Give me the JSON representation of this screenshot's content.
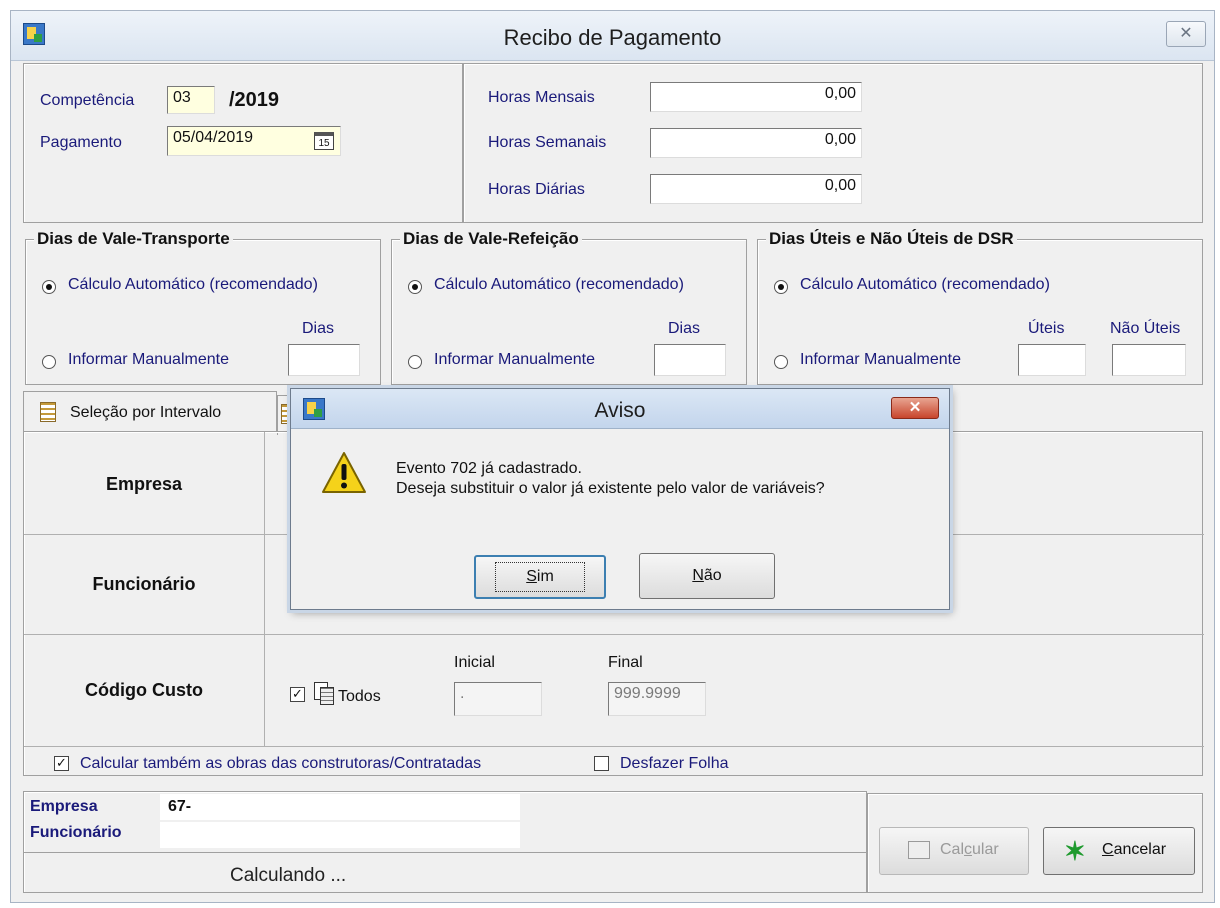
{
  "window": {
    "title": "Recibo de Pagamento",
    "close_glyph": "✕"
  },
  "competencia": {
    "label": "Competência",
    "month": "03",
    "year": "/2019"
  },
  "pagamento": {
    "label": "Pagamento",
    "date": "05/04/2019",
    "cal_glyph": "15"
  },
  "horas": {
    "mensais_label": "Horas Mensais",
    "mensais_value": "0,00",
    "semanais_label": "Horas Semanais",
    "semanais_value": "0,00",
    "diarias_label": "Horas Diárias",
    "diarias_value": "0,00"
  },
  "vale_transporte": {
    "title": "Dias de Vale-Transporte",
    "auto_label": "Cálculo Automático (recomendado)",
    "manual_label": "Informar Manualmente",
    "dias_label": "Dias"
  },
  "vale_refeicao": {
    "title": "Dias de Vale-Refeição",
    "auto_label": "Cálculo Automático (recomendado)",
    "manual_label": "Informar Manualmente",
    "dias_label": "Dias"
  },
  "dsr": {
    "title": "Dias Úteis e Não Úteis de DSR",
    "auto_label": "Cálculo Automático (recomendado)",
    "manual_label": "Informar Manualmente",
    "uteis_label": "Úteis",
    "nao_uteis_label": "Não Úteis"
  },
  "tabs": {
    "selecao_intervalo": "Seleção por Intervalo"
  },
  "rows": {
    "empresa": "Empresa",
    "funcionario": "Funcionário",
    "codigo_custo": "Código Custo"
  },
  "custo": {
    "todos_label": "Todos",
    "inicial_label": "Inicial",
    "inicial_value": ".",
    "final_label": "Final",
    "final_value": "999.9999"
  },
  "options": {
    "calcular_obras": "Calcular também as obras das construtoras/Contratadas",
    "desfazer_folha": "Desfazer Folha"
  },
  "status": {
    "empresa_label": "Empresa",
    "empresa_value": "67-",
    "funcionario_label": "Funcionário",
    "progress_text": "Calculando ..."
  },
  "buttons": {
    "calcular_pre": "Cal",
    "calcular_u": "c",
    "calcular_post": "ular",
    "cancelar_u": "C",
    "cancelar_post": "ancelar"
  },
  "dialog": {
    "title": "Aviso",
    "close_glyph": "✕",
    "line1": "Evento 702 já cadastrado.",
    "line2": "Deseja substituir o valor já existente pelo valor de variáveis?",
    "sim_u": "S",
    "sim_post": "im",
    "nao_u": "N",
    "nao_post": "ão"
  },
  "colors": {
    "label_blue": "#1a1a7a",
    "dialog_close": "#c8452c",
    "cancel_green": "#1f9a2e"
  }
}
